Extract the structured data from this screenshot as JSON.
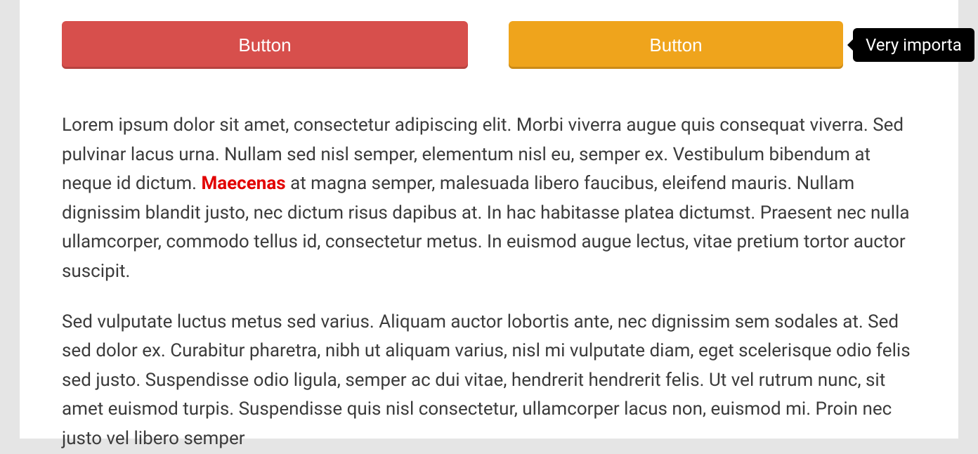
{
  "buttons": {
    "red_label": "Button",
    "orange_label": "Button"
  },
  "tooltip": {
    "text": "Very importa"
  },
  "paragraphs": {
    "p1_before": "Lorem ipsum dolor sit amet, consectetur adipiscing elit. Morbi viverra augue quis consequat viverra. Sed pulvinar lacus urna. Nullam sed nisl semper, elementum nisl eu, semper ex. Vestibulum bibendum at neque id dictum. ",
    "p1_highlight": "Maecenas",
    "p1_after": " at magna semper, malesuada libero faucibus, eleifend mauris. Nullam dignissim blandit justo, nec dictum risus dapibus at. In hac habitasse platea dictumst. Praesent nec nulla ullamcorper, commodo tellus id, consectetur metus. In euismod augue lectus, vitae pretium tortor auctor suscipit.",
    "p2": "Sed vulputate luctus metus sed varius. Aliquam auctor lobortis ante, nec dignissim sem sodales at. Sed sed dolor ex. Curabitur pharetra, nibh ut aliquam varius, nisl mi vulputate diam, eget scelerisque odio felis sed justo. Suspendisse odio ligula, semper ac dui vitae, hendrerit hendrerit felis. Ut vel rutrum nunc, sit amet euismod turpis. Suspendisse quis nisl consectetur, ullamcorper lacus non, euismod mi. Proin nec justo vel libero semper"
  },
  "colors": {
    "red_button": "#d74f4c",
    "orange_button": "#efa41c",
    "highlight_text": "#e20000",
    "tooltip_bg": "#000000"
  }
}
